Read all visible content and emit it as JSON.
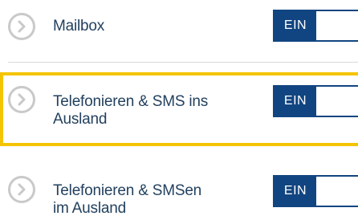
{
  "accent_color": "#114581",
  "highlight_color": "#f5c400",
  "rows": [
    {
      "label_lines": [
        "Mailbox"
      ],
      "toggle_label": "EIN",
      "state": "on",
      "icon": "chevron-right-circle-icon"
    },
    {
      "label_lines": [
        "Telefonieren & SMS ins",
        "Ausland"
      ],
      "toggle_label": "EIN",
      "state": "on",
      "highlighted": true,
      "icon": "chevron-right-circle-icon"
    },
    {
      "label_lines": [
        "Telefonieren & SMSen",
        "im Ausland"
      ],
      "toggle_label": "EIN",
      "state": "on",
      "icon": "chevron-right-circle-icon"
    }
  ]
}
